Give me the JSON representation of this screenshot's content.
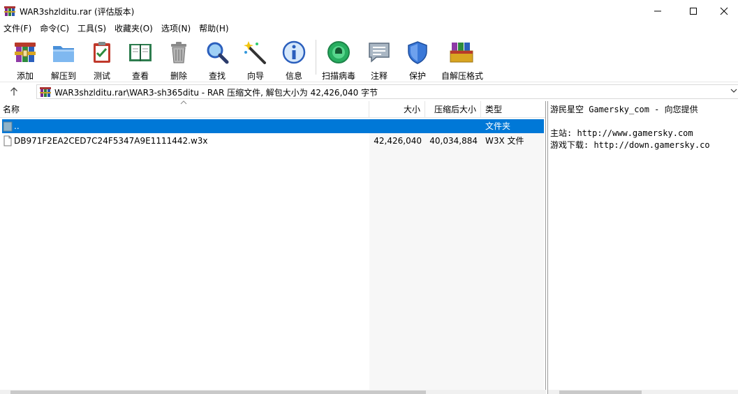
{
  "window": {
    "title": "WAR3shzlditu.rar (评估版本)"
  },
  "menu": [
    {
      "label": "文件(F)"
    },
    {
      "label": "命令(C)"
    },
    {
      "label": "工具(S)"
    },
    {
      "label": "收藏夹(O)"
    },
    {
      "label": "选项(N)"
    },
    {
      "label": "帮助(H)"
    }
  ],
  "toolbar": {
    "buttons": [
      {
        "label": "添加",
        "icon": "add-archive-icon"
      },
      {
        "label": "解压到",
        "icon": "extract-folder-icon"
      },
      {
        "label": "测试",
        "icon": "test-clipboard-icon"
      },
      {
        "label": "查看",
        "icon": "view-book-icon"
      },
      {
        "label": "删除",
        "icon": "trash-icon"
      },
      {
        "label": "查找",
        "icon": "magnifier-icon"
      },
      {
        "label": "向导",
        "icon": "wizard-wand-icon"
      },
      {
        "label": "信息",
        "icon": "info-icon"
      },
      {
        "label": "扫描病毒",
        "icon": "virus-scan-icon"
      },
      {
        "label": "注释",
        "icon": "comment-note-icon"
      },
      {
        "label": "保护",
        "icon": "shield-icon"
      },
      {
        "label": "自解压格式",
        "icon": "sfx-box-icon"
      }
    ]
  },
  "address": {
    "path": "WAR3shzlditu.rar\\WAR3-sh365ditu - RAR 压缩文件, 解包大小为 42,426,040 字节"
  },
  "columns": {
    "name": "名称",
    "size": "大小",
    "packed": "压缩后大小",
    "type": "类型"
  },
  "files": [
    {
      "name": "..",
      "size": "",
      "packed": "",
      "type": "文件夹",
      "selected": true
    },
    {
      "name": "DB971F2EA2CED7C24F5347A9E1111442.w3x",
      "size": "42,426,040",
      "packed": "40,034,884",
      "type": "W3X 文件",
      "selected": false
    }
  ],
  "comment": {
    "line1": "游民星空 Gamersky_com - 向您提供",
    "line2": "主站: http://www.gamersky.com",
    "line3": "游戏下载: http://down.gamersky.co"
  },
  "colors": {
    "selection": "#0078d7"
  }
}
